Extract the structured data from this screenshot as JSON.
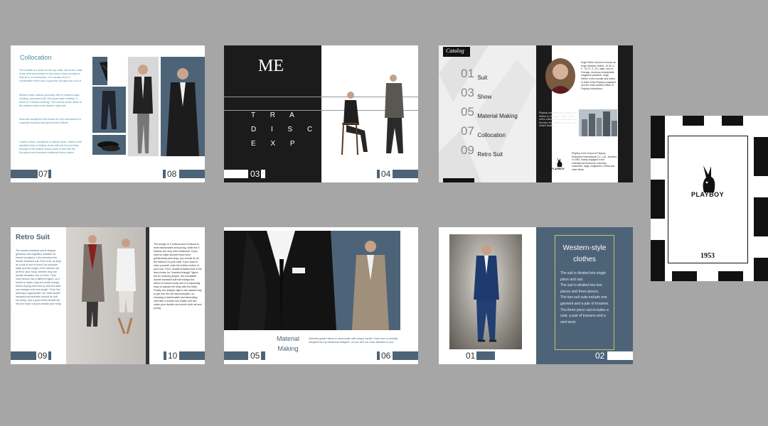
{
  "spreads": {
    "s1": {
      "title": "Collocation",
      "para1": "The necktie is a dress on the top collar, tied at the collar of the shirt and knotted on the chest, which includes a bow tie or a formal piece. It is usually worn in combination with a suit. A good tie can give you a lot of",
      "para2": "Western-style clothes generally refer to western-style clothing, compared with \"European style clothing\" in terms of \"Chinese clothing\". The narrow sense refers to the western suits in the western style suit.",
      "para3": "Suits are usually the first choice for men and women in corporate business and government offices.",
      "para4": "Leather shoes, compared to casual shoes, refers to the specified style of leather shoes with the formal dress, belongs to the leather shoes made in line with the European and American traditional dress culture.",
      "page_left": "07",
      "page_right": "08"
    },
    "s2": {
      "heading": "ME",
      "letters": [
        "T R A",
        "D I S C",
        "E X P"
      ],
      "page_left": "03",
      "page_right": "04"
    },
    "s3": {
      "badge": "Catalog",
      "items": [
        {
          "num": "01",
          "label": "Suit"
        },
        {
          "num": "03",
          "label": "Show"
        },
        {
          "num": "05",
          "label": "Material Making"
        },
        {
          "num": "07",
          "label": "Collocation"
        },
        {
          "num": "09",
          "label": "Retro Suit"
        }
      ],
      "bio1": "Hugh Hefner (former's known as Hugh Marston Hefner, 19.26, 4, 9 - 20.17, 9, 27), male, born in Chicago, American industrialist, magazine publisher. Hugh Hefner is the founder and editor-in-chief of the Playboy magazine and the chief creative officer of Playboy enterprises.",
      "bio2": "Playboy magazine was founded by Hefner in Chicago in 1953. It is a men's collective enterprise listed on the New York stock exchange in the United States.",
      "bio3": "Playboy is the brand of Playboy Enterprise International Co., Ltd., founded in 1953, mainly engaged in the entertainment industry, including cosmetics, bags, magazines, media and other fields.",
      "logo_text": "PLAYBOY"
    },
    "cover": {
      "logo_text": "PLAYBOY",
      "year": "1953"
    },
    "s4": {
      "title": "Retro Suit",
      "left_text": "The double-breasted suit is elegant, generous and dignified, suitable for formal occasions. Let's introduce the double breasted suit. First of all, as long as a suit of suit is found, the shoulder width and the length of the sleeves are all fit for your body, whether they are double breasted, two or three. Then each person has a different figure, so it needs to make a big and small change before buying each suit so that the tailor can change to its own length. Thus, the tailoring is appropriate, the retail double breasted suit shoulder should be soft, not sharp, and a good dress should set off your body, not just outside your body.",
      "right_text": "The design of 2 buttons and 6 buttons is more fashionable and young, while the 4 buttons are very retro traditional. If you want to make yourself look more gentlemanly and artsy, you should tie all the buttons on your coat. If you want to relax yourself, untie the bottom button of your suit. Then, double breasted suit is the best choice for \"inverted triangle\" figure, but for ordinary people, the unsuitable double breasted suit will enlarge the defect of human body, and it is especially easy to expose the body with the belly. Finally, the antique style is the easiest way to get into the old misconception, so choosing a fashionable and decorating shirt with a double row buckle suit can make your double row buckle both old and young.",
      "page_left": "09",
      "page_right": "10"
    },
    "s5": {
      "title_line1": "Material",
      "title_line2": "Making",
      "body": "Selected golden fleece is hand-made with unique handle. Each one is carefully designed by a professional designer. Let you feel our close attention to you.",
      "page_left": "05",
      "page_right": "06"
    },
    "s6": {
      "title_line1": "Western-style",
      "title_line2": "clothes",
      "body": [
        "The suit is divided into single piece and suit.",
        "The suit is divided into two pieces and three pieces.",
        "The two suit suits include one garment and a pair of trousers.",
        "The three piece suit includes a coat, a pair of trousers and a vest west."
      ],
      "page_left": "01",
      "page_right": "02"
    }
  },
  "colors": {
    "background": "#a6a6a6",
    "slate": "#4d6478",
    "teal_text": "#4a8fa0",
    "black": "#1b1b1b"
  }
}
